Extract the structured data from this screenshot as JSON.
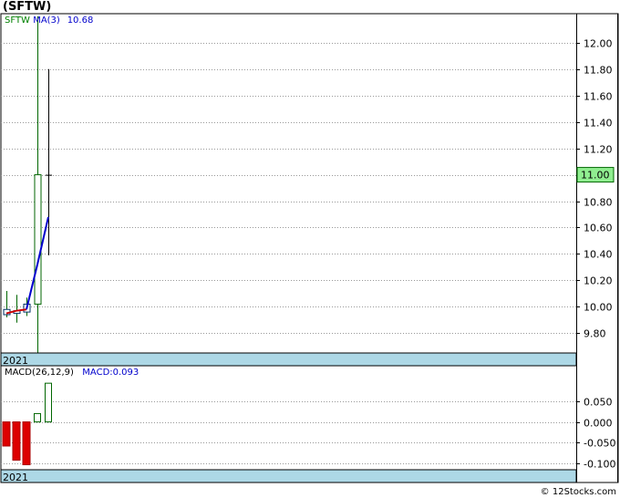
{
  "title": "(SFTW)",
  "footer": "© 12Stocks.com",
  "chart_data": [
    {
      "type": "candlestick",
      "panel": "price",
      "legend": [
        {
          "text": "SFTW",
          "color": "#008000"
        },
        {
          "text": "MA(3)",
          "color": "#0000cc"
        },
        {
          "text": "10.68",
          "color": "#0000cc"
        }
      ],
      "year_label": "2021",
      "last_price_label": "11.00",
      "ylim": [
        9.65,
        12.22
      ],
      "yticks": [
        9.8,
        10.0,
        10.2,
        10.4,
        10.6,
        10.8,
        11.0,
        11.2,
        11.4,
        11.6,
        11.8,
        12.0
      ],
      "grid": true,
      "candles": [
        {
          "open": 9.94,
          "high": 10.12,
          "low": 9.92,
          "close": 9.98
        },
        {
          "open": 9.97,
          "high": 10.09,
          "low": 9.88,
          "close": 9.95
        },
        {
          "open": 9.96,
          "high": 10.07,
          "low": 9.93,
          "close": 10.02
        },
        {
          "open": 10.02,
          "high": 12.2,
          "low": 9.65,
          "close": 11.0
        },
        {
          "open": 11.0,
          "high": 11.8,
          "low": 10.39,
          "close": 11.0
        }
      ],
      "ma3": [
        9.95,
        9.97,
        9.98,
        10.32,
        10.68
      ],
      "ma3_segment_colors": [
        "#cc0000",
        "#cc0000",
        "#0000cc",
        "#0000cc"
      ]
    },
    {
      "type": "bar",
      "panel": "macd",
      "legend": [
        {
          "text": "MACD(26,12,9)",
          "color": "#000000"
        },
        {
          "text": "MACD:0.093",
          "color": "#0000cc"
        }
      ],
      "year_label": "2021",
      "ylim": [
        -0.115,
        0.135
      ],
      "yticks": [
        -0.1,
        -0.05,
        0.0,
        0.05
      ],
      "ytick_labels": [
        "-0.100",
        "-0.050",
        "0.000",
        "0.050"
      ],
      "grid": true,
      "values": [
        -0.058,
        -0.092,
        -0.103,
        0.02,
        0.093
      ]
    }
  ]
}
